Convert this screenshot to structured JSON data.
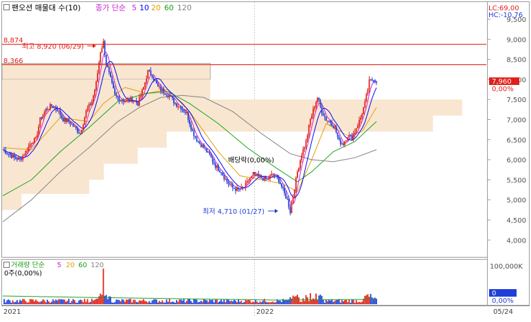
{
  "header": {
    "checkbox_state": "unchecked",
    "title": "팬오션 매물대 수(10)",
    "ma_label": "종가 단순",
    "ma_periods": [
      "5",
      "10",
      "20",
      "60",
      "120"
    ],
    "ma_colors": [
      "#d01fd0",
      "#0000ff",
      "#e0a000",
      "#19a019",
      "#808080"
    ],
    "lc_label": "LC:69,00",
    "hc_label": "HC:-10,76"
  },
  "price_axis": {
    "ticks": [
      "9,500",
      "9,000",
      "8,500",
      "8,000",
      "7,500",
      "7,000",
      "6,500",
      "6,000",
      "5,500",
      "5,000",
      "4,500",
      "4,000"
    ],
    "current_price": "7,960",
    "current_change": "0,00%"
  },
  "lines": [
    {
      "label": "8,874",
      "value": 8874
    },
    {
      "label": "8,366",
      "value": 8366
    }
  ],
  "annotations": {
    "high": "최고 8,920 (06/29)",
    "low": "최저 4,710 (01/27)",
    "dividend": "배당락(0,00%)"
  },
  "volume_panel": {
    "ma_label": "거래량 단순",
    "ma_periods": [
      "5",
      "20",
      "60",
      "120"
    ],
    "ma_colors": [
      "#d01fd0",
      "#e0a000",
      "#19a019",
      "#808080"
    ],
    "sub_label": "0주(0,00%)",
    "axis_top": "100,000K",
    "current_value": "0",
    "current_change": "0,00%"
  },
  "date_axis": {
    "labels": [
      "2021",
      "2022"
    ],
    "right_label": "05/24"
  },
  "colors": {
    "up": "#e0201a",
    "down": "#1f3fd8",
    "line": "#e0201a",
    "volume_profile": "#f8e6d0"
  },
  "chart_data": {
    "type": "candlestick",
    "title": "팬오션 매물대 수(10)",
    "y_unit": "KRW",
    "ylim": [
      4000,
      9500
    ],
    "x_labels": [
      "2021",
      "2022",
      "05/24"
    ],
    "price_path": [
      [
        0,
        6250
      ],
      [
        4,
        6150
      ],
      [
        8,
        6050
      ],
      [
        12,
        6000
      ],
      [
        16,
        6200
      ],
      [
        20,
        6450
      ],
      [
        23,
        6500
      ],
      [
        26,
        7000
      ],
      [
        30,
        7250
      ],
      [
        34,
        7350
      ],
      [
        38,
        7250
      ],
      [
        42,
        7000
      ],
      [
        46,
        6950
      ],
      [
        50,
        6800
      ],
      [
        54,
        6650
      ],
      [
        58,
        7200
      ],
      [
        62,
        7450
      ],
      [
        65,
        7900
      ],
      [
        68,
        8700
      ],
      [
        70,
        8920
      ],
      [
        72,
        8400
      ],
      [
        75,
        8000
      ],
      [
        78,
        7600
      ],
      [
        82,
        7500
      ],
      [
        86,
        7450
      ],
      [
        90,
        7500
      ],
      [
        94,
        7400
      ],
      [
        98,
        7800
      ],
      [
        101,
        8200
      ],
      [
        104,
        8100
      ],
      [
        108,
        7800
      ],
      [
        112,
        7700
      ],
      [
        116,
        7600
      ],
      [
        120,
        7400
      ],
      [
        124,
        7300
      ],
      [
        128,
        7150
      ],
      [
        132,
        6700
      ],
      [
        136,
        6450
      ],
      [
        140,
        6300
      ],
      [
        144,
        6100
      ],
      [
        148,
        5850
      ],
      [
        152,
        5700
      ],
      [
        156,
        5450
      ],
      [
        160,
        5300
      ],
      [
        164,
        5250
      ],
      [
        168,
        5300
      ],
      [
        172,
        5550
      ],
      [
        176,
        5600
      ],
      [
        180,
        5550
      ],
      [
        184,
        5500
      ],
      [
        188,
        5650
      ],
      [
        192,
        5500
      ],
      [
        196,
        5150
      ],
      [
        198,
        5000
      ],
      [
        200,
        4710
      ],
      [
        202,
        5100
      ],
      [
        205,
        5700
      ],
      [
        208,
        6150
      ],
      [
        211,
        6450
      ],
      [
        214,
        7000
      ],
      [
        217,
        7350
      ],
      [
        219,
        7550
      ],
      [
        222,
        7200
      ],
      [
        225,
        7000
      ],
      [
        228,
        6950
      ],
      [
        231,
        6800
      ],
      [
        234,
        6450
      ],
      [
        237,
        6400
      ],
      [
        240,
        6600
      ],
      [
        243,
        6550
      ],
      [
        246,
        6800
      ],
      [
        249,
        7050
      ],
      [
        252,
        7400
      ],
      [
        255,
        7950
      ],
      [
        258,
        8000
      ],
      [
        260,
        7960
      ]
    ],
    "ma_series": [
      {
        "name": "20",
        "values": [
          [
            0,
            6300
          ],
          [
            20,
            6250
          ],
          [
            40,
            7050
          ],
          [
            60,
            6950
          ],
          [
            70,
            7400
          ],
          [
            85,
            7800
          ],
          [
            100,
            7650
          ],
          [
            115,
            7750
          ],
          [
            130,
            7200
          ],
          [
            150,
            6200
          ],
          [
            165,
            5600
          ],
          [
            180,
            5500
          ],
          [
            195,
            5400
          ],
          [
            205,
            5200
          ],
          [
            215,
            6000
          ],
          [
            225,
            6900
          ],
          [
            240,
            6600
          ],
          [
            250,
            6700
          ],
          [
            260,
            7300
          ]
        ]
      },
      {
        "name": "60",
        "values": [
          [
            0,
            5100
          ],
          [
            20,
            5500
          ],
          [
            40,
            6200
          ],
          [
            60,
            6800
          ],
          [
            80,
            7450
          ],
          [
            100,
            7650
          ],
          [
            115,
            7700
          ],
          [
            130,
            7400
          ],
          [
            150,
            6900
          ],
          [
            170,
            6300
          ],
          [
            190,
            5800
          ],
          [
            205,
            5450
          ],
          [
            215,
            5700
          ],
          [
            230,
            6200
          ],
          [
            245,
            6450
          ],
          [
            260,
            6950
          ]
        ]
      },
      {
        "name": "120",
        "values": [
          [
            0,
            4450
          ],
          [
            20,
            5000
          ],
          [
            40,
            5700
          ],
          [
            60,
            6300
          ],
          [
            80,
            6950
          ],
          [
            95,
            7300
          ],
          [
            110,
            7550
          ],
          [
            125,
            7600
          ],
          [
            140,
            7550
          ],
          [
            160,
            7200
          ],
          [
            180,
            6650
          ],
          [
            200,
            6150
          ],
          [
            215,
            6000
          ],
          [
            230,
            5950
          ],
          [
            245,
            6050
          ],
          [
            260,
            6250
          ]
        ]
      }
    ],
    "horizontal_lines": [
      8874,
      8366
    ],
    "volume_profile": [
      {
        "from": 8000,
        "to": 8400,
        "length": 0.43
      },
      {
        "from": 7500,
        "to": 8000,
        "length": 0.43
      },
      {
        "from": 7100,
        "to": 7500,
        "length": 0.95
      },
      {
        "from": 6700,
        "to": 7100,
        "length": 0.89
      },
      {
        "from": 6300,
        "to": 6700,
        "length": 0.34
      },
      {
        "from": 5900,
        "to": 6300,
        "length": 0.28
      },
      {
        "from": 5500,
        "to": 5900,
        "length": 0.21
      },
      {
        "from": 5150,
        "to": 5500,
        "length": 0.18
      },
      {
        "from": 4750,
        "to": 5150,
        "length": 0.04
      }
    ]
  }
}
